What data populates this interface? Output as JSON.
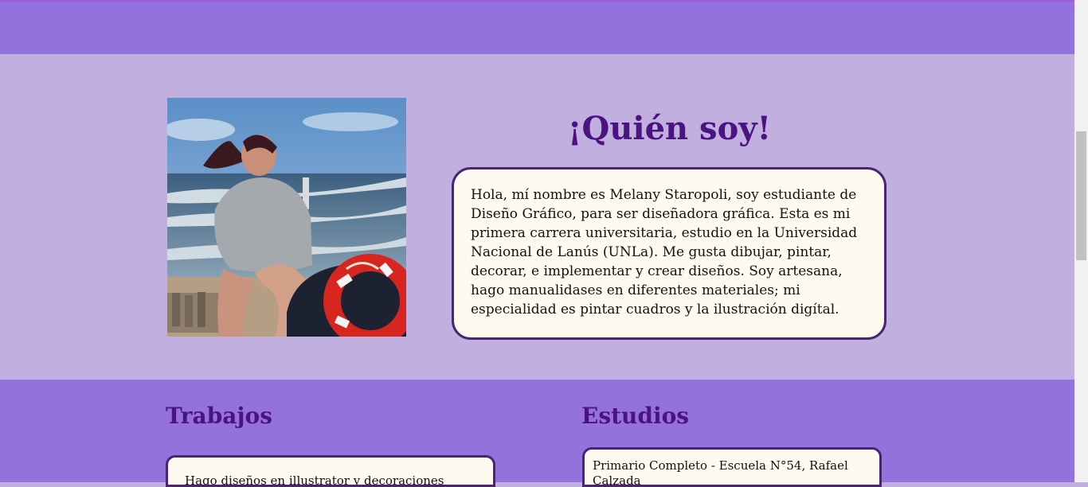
{
  "about": {
    "title": "¡Quién soy!",
    "bio": "Hola, mí nombre es Melany Staropoli, soy estudiante de Diseño Gráfico, para ser diseñadora gráfica. Esta es mi primera carrera universitaria, estudio en la Universidad Nacional de Lanús (UNLa). Me gusta dibujar, pintar, decorar, e implementar y crear diseños. Soy artesana, hago manualidases en diferentes materiales; mi especialidad es pintar cuadros y la ilustración digítal."
  },
  "trabajos": {
    "title": "Trabajos",
    "text": "Hago diseños en illustrator y decoraciones manuales"
  },
  "estudios": {
    "title": "Estudios",
    "text": "Primario Completo - Escuela N°54, Rafael Calzada"
  },
  "colors": {
    "header_band": "#9472de",
    "about_background": "#c1afe0",
    "heading": "#4b1382",
    "card_background": "#fffaf0",
    "card_border": "#4a2470"
  }
}
